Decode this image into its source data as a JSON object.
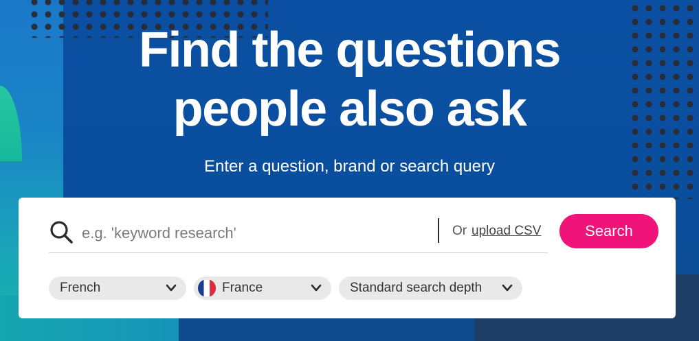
{
  "hero": {
    "title_line1": "Find the questions",
    "title_line2": "people also ask",
    "subtitle": "Enter a question, brand or search query"
  },
  "search": {
    "placeholder": "e.g. 'keyword research'",
    "value": "",
    "or_text": "Or",
    "upload_label": "upload CSV",
    "button_label": "Search",
    "icon": "search-icon"
  },
  "filters": {
    "language": {
      "value": "French",
      "icon": "chevron-down-icon"
    },
    "country": {
      "value": "France",
      "icon": "france-flag-icon"
    },
    "depth": {
      "value": "Standard search depth",
      "icon": "chevron-down-icon"
    }
  },
  "colors": {
    "background": "#0a4fa0",
    "accent": "#f0137a",
    "card": "#ffffff",
    "pill": "#e9e9e9"
  }
}
